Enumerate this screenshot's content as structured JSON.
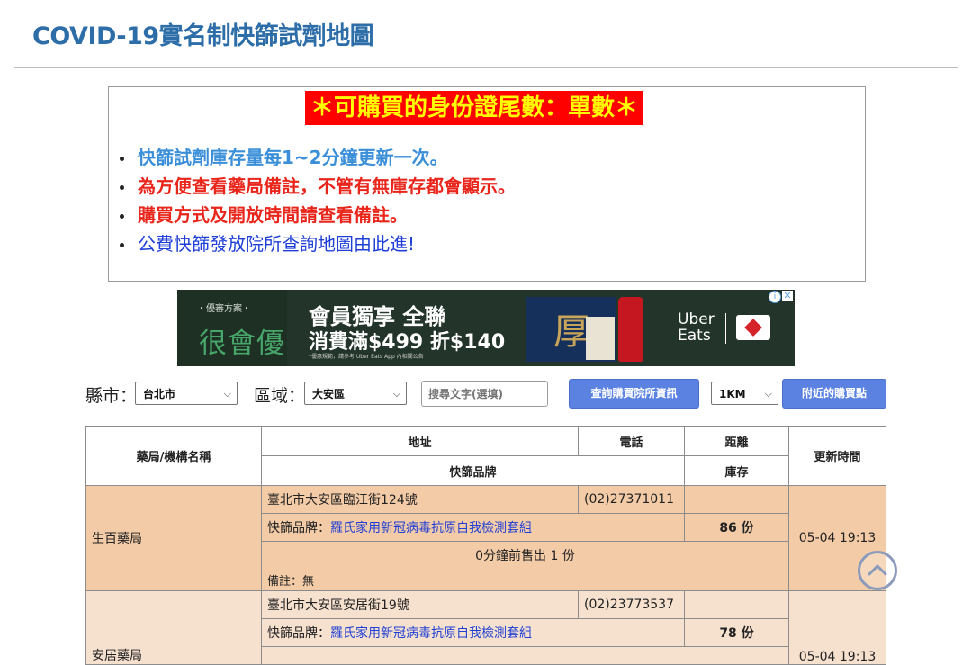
{
  "page": {
    "title": "COVID-19實名制快篩試劑地圖"
  },
  "notice": {
    "headline": "＊可購買的身份證尾數：單數＊",
    "items": [
      {
        "text": "快篩試劑庫存量每1~2分鐘更新一次。",
        "style": "blue"
      },
      {
        "text": "為方便查看藥局備註，不管有無庫存都會顯示。",
        "style": "red"
      },
      {
        "text": "購買方式及開放時間請查看備註。",
        "style": "red"
      },
      {
        "text": "公費快篩發放院所查詢地圖由此進!",
        "style": "link"
      }
    ]
  },
  "ad": {
    "tagline": "・優審方案・",
    "brand": "很會優",
    "line1": "會員獨享 全聯",
    "line2": "消費滿$499 折$140",
    "fine_print": "*優惠規範，請參考 Uber Eats App 內相關公告",
    "product_glyph": "厚",
    "partner_line1": "Uber",
    "partner_line2": "Eats",
    "info_glyph": "i",
    "close_glyph": "✕"
  },
  "filters": {
    "county_label": "縣市：",
    "county_value": "台北市",
    "district_label": "區域：",
    "district_value": "大安區",
    "search_placeholder": "搜尋文字(選填)",
    "query_button": "查詢購買院所資訊",
    "radius_value": "1KM",
    "nearby_button": "附近的購買點",
    "chevron": "⌵"
  },
  "table": {
    "headers": {
      "name": "藥局/機構名稱",
      "address": "地址",
      "phone": "電話",
      "distance": "距離",
      "brand": "快篩品牌",
      "stock": "庫存",
      "updated": "更新時間"
    },
    "rows": [
      {
        "name": "生百藥局",
        "address": "臺北市大安區臨江街124號",
        "phone": "(02)27371011",
        "distance": "",
        "brand_label": "快篩品牌：",
        "brand_value": "羅氏家用新冠病毒抗原自我檢測套組",
        "stock": "86 份",
        "sold": "0分鐘前售出 1 份",
        "note": "備註：無",
        "updated": "05-04 19:13"
      },
      {
        "name": "安居藥局",
        "address": "臺北市大安區安居街19號",
        "phone": "(02)23773537",
        "distance": "",
        "brand_label": "快篩品牌：",
        "brand_value": "羅氏家用新冠病毒抗原自我檢測套組",
        "stock": "78 份",
        "updated": "05-04 19:13"
      }
    ]
  },
  "colors": {
    "title": "#2d6da8",
    "headline_bg": "#ff0000",
    "headline_fg": "#ffff00",
    "button": "#5b82e0",
    "row1": "#f3cba7",
    "row2": "#f6e0ce",
    "stock": "#4a8a16",
    "note": "#e0389a"
  }
}
